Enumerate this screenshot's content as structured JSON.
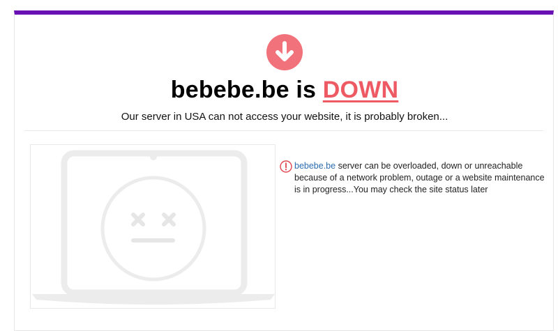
{
  "header": {
    "domain": "bebebe.be",
    "connector": "is",
    "status": "DOWN",
    "subtitle": "Our server in USA can not access your website, it is probably broken..."
  },
  "message": {
    "domain_link": "bebebe.be",
    "body": " server can be overloaded, down or unreachable because of a network problem, outage or a website maintenance is in progress...You may check the site status later"
  },
  "icons": {
    "status": "arrow-down-circle-icon",
    "warning": "exclamation-circle-icon",
    "illustration": "broken-laptop-face"
  },
  "colors": {
    "accent_bar": "#6a11b5",
    "down_red": "#ee5a63",
    "icon_red": "#f2727b",
    "link_blue": "#2b6cb0"
  }
}
